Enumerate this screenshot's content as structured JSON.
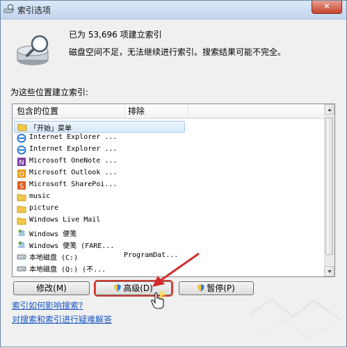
{
  "window": {
    "title": "索引选项",
    "close_glyph": "✕"
  },
  "status": {
    "count_text": "已为 53,696 项建立索引",
    "message": "磁盘空间不足，无法继续进行索引。搜索结果可能不完全。"
  },
  "locations_label": "为这些位置建立索引:",
  "list": {
    "columns": [
      "包含的位置",
      "排除"
    ],
    "rows": [
      {
        "icon": "folder-icon",
        "name": "「开始」菜单",
        "exclude": "",
        "selected": true
      },
      {
        "icon": "ie-icon",
        "name": "Internet Explorer ...",
        "exclude": ""
      },
      {
        "icon": "ie-icon",
        "name": "Internet Explorer ...",
        "exclude": ""
      },
      {
        "icon": "onenote-icon",
        "name": "Microsoft OneNote ...",
        "exclude": ""
      },
      {
        "icon": "outlook-icon",
        "name": "Microsoft Outlook ...",
        "exclude": ""
      },
      {
        "icon": "sharepoint-icon",
        "name": "Microsoft SharePoi...",
        "exclude": ""
      },
      {
        "icon": "folder-icon",
        "name": "music",
        "exclude": ""
      },
      {
        "icon": "folder-icon",
        "name": "picture",
        "exclude": ""
      },
      {
        "icon": "folder-icon",
        "name": "Windows Live Mail",
        "exclude": ""
      },
      {
        "icon": "contacts-icon",
        "name": "Windows 便笺",
        "exclude": ""
      },
      {
        "icon": "contacts-icon",
        "name": "Windows 便笺 (FARE...",
        "exclude": ""
      },
      {
        "icon": "drive-icon",
        "name": "本地磁盘 (C:)",
        "exclude": "ProgramDat..."
      },
      {
        "icon": "drive-icon",
        "name": "本地磁盘 (Q:) (不...",
        "exclude": ""
      },
      {
        "icon": "drive-icon",
        "name": "...",
        "exclude": ""
      }
    ]
  },
  "buttons": {
    "modify": "修改(M)",
    "advanced": "高级(D)",
    "pause": "暂停(P)"
  },
  "links": {
    "how_indexing": "索引如何影响搜索?",
    "troubleshoot": "对搜索和索引进行疑难解答"
  },
  "colors": {
    "link": "#1a57c6",
    "highlight_border": "#d43a2f",
    "selection": "#d9eafb"
  }
}
